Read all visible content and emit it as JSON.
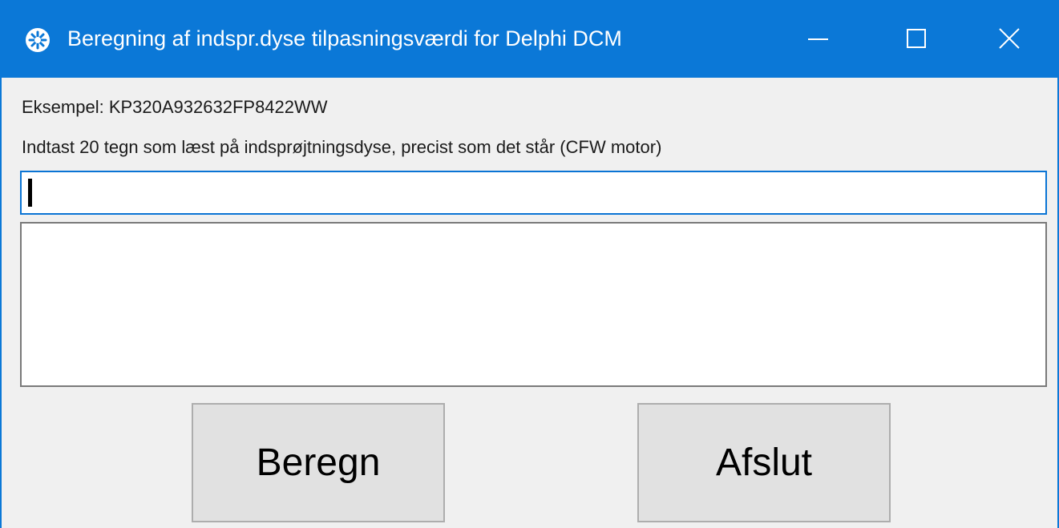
{
  "window": {
    "title": "Beregning af indspr.dyse tilpasningsværdi for Delphi DCM",
    "accent_color": "#0b78d7",
    "app_icon": "settings-gear-icon",
    "controls": {
      "minimize_icon": "minimize-icon",
      "maximize_icon": "maximize-icon",
      "close_icon": "close-icon"
    }
  },
  "form": {
    "example_label": "Eksempel: KP320A932632FP8422WW",
    "instruction_label": "Indtast 20 tegn som læst på indsprøjtningsdyse, precist som det står (CFW motor)",
    "code_input_value": "",
    "result_text": ""
  },
  "buttons": {
    "calculate_label": "Beregn",
    "exit_label": "Afslut"
  }
}
